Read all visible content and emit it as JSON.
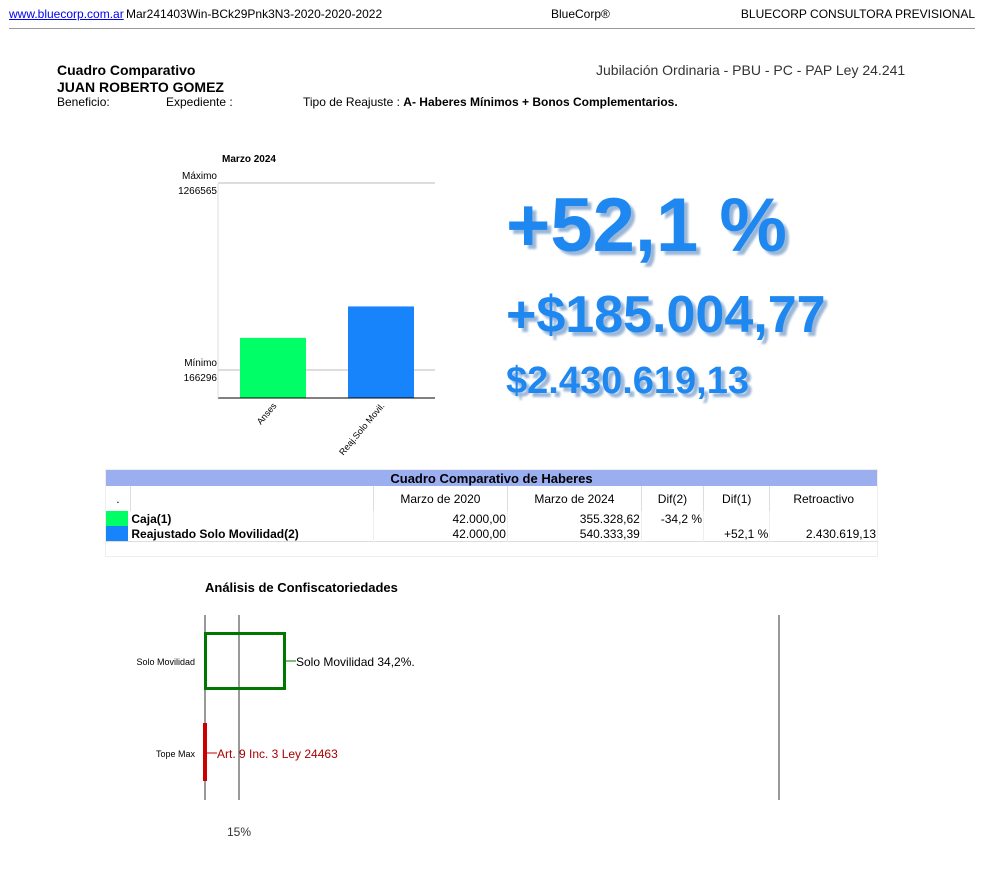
{
  "header": {
    "site_link": "www.bluecorp.com.ar",
    "doc_code": "Mar241403Win-BCk29Pnk3N3-2020-2020-2022",
    "brand": "BlueCorp®",
    "company": "BLUECORP CONSULTORA PREVISIONAL"
  },
  "info": {
    "title": "Cuadro Comparativo",
    "person": "JUAN ROBERTO GOMEZ",
    "benefit_type": "Jubilación Ordinaria - PBU - PC - PAP Ley 24.241",
    "beneficio_label": "Beneficio:",
    "expediente_label": "Expediente :",
    "reajuste_label": "Tipo de Reajuste :",
    "reajuste_value": "A- Haberes Mínimos + Bonos Complementarios."
  },
  "highlights": {
    "percent": "+52,1 %",
    "difference": "+$185.004,77",
    "retroactive": "$2.430.619,13",
    "color": "#1e88f0"
  },
  "chart_data": {
    "type": "bar",
    "title": "Marzo 2024",
    "categories": [
      "Anses",
      "Reaj.Solo Movil."
    ],
    "values": [
      355328.62,
      540333.39
    ],
    "colors": [
      "#00ff66",
      "#1784fb"
    ],
    "max_label": "Máximo",
    "max_value": "1266565",
    "min_label": "Mínimo",
    "min_value": "166296",
    "ylim": [
      166296,
      1266565
    ]
  },
  "table": {
    "title": "Cuadro Comparativo de Haberes",
    "columns": [
      ".",
      "",
      "Marzo de 2020",
      "Marzo de 2024",
      "Dif(2)",
      "Dif(1)",
      "Retroactivo"
    ],
    "rows": [
      {
        "color": "#00ff66",
        "label": "Caja(1)",
        "mar2020": "42.000,00",
        "mar2024": "355.328,62",
        "dif2": "-34,2 %",
        "dif1": "",
        "retro": ""
      },
      {
        "color": "#1784fb",
        "label": "Reajustado Solo Movilidad(2)",
        "mar2020": "42.000,00",
        "mar2024": "540.333,39",
        "dif2": "",
        "dif1": "+52,1 %",
        "retro": "2.430.619,13"
      }
    ]
  },
  "analysis": {
    "title": "Análisis de Confiscatoriedades",
    "rows": [
      {
        "label": "Solo Movilidad",
        "annotation": "Solo Movilidad 34,2%.",
        "color": "#007700"
      },
      {
        "label": "Tope Max",
        "annotation": "Art. 9 Inc. 3 Ley 24463",
        "color": "#cc0000"
      }
    ],
    "axis_label": "15%"
  }
}
